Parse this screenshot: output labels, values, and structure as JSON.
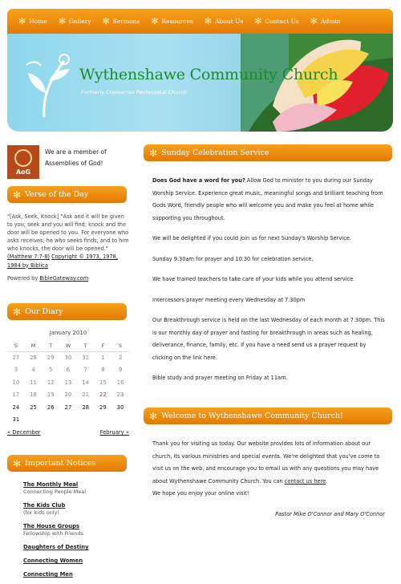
{
  "nav": {
    "items": [
      "Home",
      "Gallery",
      "Sermons",
      "Resources",
      "About Us",
      "Contact Us",
      "Admin"
    ]
  },
  "header": {
    "title": "Wythenshawe Community Church",
    "subtitle": "Formerly Crossacres Pentecostal Church"
  },
  "sidebar": {
    "aog_logo_text": "AoG",
    "member_text": "We are a member of Assemblies of God!",
    "verse_heading": "Verse of the Day",
    "verse_text": "\"[Ask, Seek, Knock] \"Ask and it will be given to you; seek and you will find; knock and the door will be opened to you. For everyone who asks receives; he who seeks finds; and to him who knocks, the door will be opened.\"",
    "verse_ref": "(Matthew 7:7-8)",
    "verse_copyright": "Copyright © 1973, 1978, 1984 by Biblica",
    "powered_prefix": "Powered by",
    "powered_link": "BibleGateway.com",
    "diary_heading": "Our Diary",
    "calendar": {
      "caption": "January 2010",
      "weekdays": [
        "S",
        "M",
        "T",
        "W",
        "T",
        "F",
        "S"
      ],
      "weeks": [
        [
          "27",
          "28",
          "29",
          "30",
          "31",
          "1",
          "2"
        ],
        [
          "3",
          "4",
          "5",
          "6",
          "7",
          "8",
          "9"
        ],
        [
          "10",
          "11",
          "12",
          "13",
          "14",
          "15",
          "16"
        ],
        [
          "17",
          "18",
          "19",
          "20",
          "21",
          "22",
          "23"
        ],
        [
          "24",
          "25",
          "26",
          "27",
          "28",
          "29",
          "30"
        ],
        [
          "31",
          "",
          "",
          "",
          "",
          "",
          ""
        ]
      ],
      "prev": "« December",
      "next": "February »"
    },
    "notices_heading": "Important Notices",
    "notices": [
      {
        "title": "The Monthly Meal",
        "sub": "Connecting People Meal"
      },
      {
        "title": "The Kids Club",
        "sub": "(for kids only)"
      },
      {
        "title": "The House Groups",
        "sub": "Fellowship with Friends"
      },
      {
        "title": "Daughters of Destiny",
        "sub": ""
      },
      {
        "title": "Connecting Women",
        "sub": ""
      },
      {
        "title": "Connecting Men",
        "sub": ""
      }
    ]
  },
  "main": {
    "service_heading": "Sunday Celebration Service",
    "service_lead_bold": "Does God have a word for you?",
    "service_lead": " Allow God to minister to you during our Sunday Worship Service. Experience great music, meaningful songs and brilliant teaching from Gods Word, friendly people who will welcome you and make you feel at home while supporting you throughout.",
    "service_p2": "We will be delighted if you could join us for next Sunday's Worship Service.",
    "service_times": "Sunday 9.30am for prayer and 10.30 for celebration service.",
    "service_kids": "We have trained teachers to take care of your kids while you attend service.",
    "service_intercessors": "Intercessors prayer meeting every Wednesday at 7.30pm",
    "service_breakthrough": "Our Breakthrough service is held on the last Wednesday of each month at 7.30pm. This is our monthly day of prayer and fasting for breakthrough in areas such as healing, deliverance, finance, family, etc.  If you have a need send us a prayer request by clicking on the link here.",
    "service_bible": "Bible study and prayer meeting on Friday at 11am.",
    "welcome_heading": "Welcome to Wythenshawe Community Church!",
    "welcome_p1": "Thank you for visiting us today. Our website provides lots of information about our church, its various ministries and special events. We're delighted that you've come to visit us on the web, and encourage you to email us with any questions you may have about Wythenshawe Community Church. You can ",
    "welcome_link": "contact us here",
    "welcome_p1_end": ".",
    "welcome_p2": "We hope you enjoy your online visit!",
    "signature": "Pastor Mike O'Connor and Mary O'Connor"
  }
}
